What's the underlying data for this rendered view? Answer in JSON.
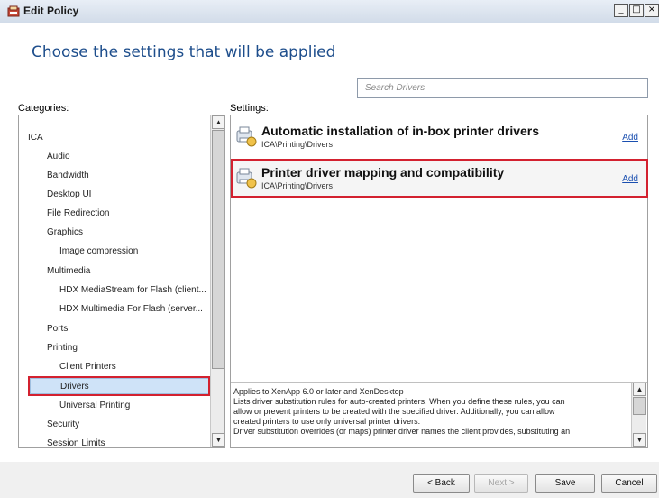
{
  "window": {
    "title": "Edit Policy",
    "controls": {
      "minimize": "_",
      "maximize": "□",
      "close": "×"
    }
  },
  "heading": "Choose the settings that will be applied",
  "search": {
    "placeholder": "Search Drivers"
  },
  "categories": {
    "label": "Categories:",
    "items": [
      {
        "label": "ICA",
        "level": 0,
        "selected": false
      },
      {
        "label": "Audio",
        "level": 1,
        "selected": false
      },
      {
        "label": "Bandwidth",
        "level": 1,
        "selected": false
      },
      {
        "label": "Desktop UI",
        "level": 1,
        "selected": false
      },
      {
        "label": "File Redirection",
        "level": 1,
        "selected": false
      },
      {
        "label": "Graphics",
        "level": 1,
        "selected": false
      },
      {
        "label": "Image compression",
        "level": 2,
        "selected": false
      },
      {
        "label": "Multimedia",
        "level": 1,
        "selected": false
      },
      {
        "label": "HDX MediaStream for Flash (client...",
        "level": 2,
        "selected": false
      },
      {
        "label": "HDX Multimedia For Flash (server...",
        "level": 2,
        "selected": false
      },
      {
        "label": "Ports",
        "level": 1,
        "selected": false
      },
      {
        "label": "Printing",
        "level": 1,
        "selected": false
      },
      {
        "label": "Client Printers",
        "level": 2,
        "selected": false
      },
      {
        "label": "Drivers",
        "level": 2,
        "selected": true
      },
      {
        "label": "Universal Printing",
        "level": 2,
        "selected": false
      },
      {
        "label": "Security",
        "level": 1,
        "selected": false
      },
      {
        "label": "Session Limits",
        "level": 1,
        "selected": false
      }
    ]
  },
  "settings": {
    "label": "Settings:",
    "items": [
      {
        "title": "Automatic installation of in-box printer drivers",
        "path": "ICA\\Printing\\Drivers",
        "action": "Add"
      },
      {
        "title": "Printer driver mapping and compatibility",
        "path": "ICA\\Printing\\Drivers",
        "action": "Add"
      }
    ]
  },
  "description": {
    "lines": [
      "Applies to XenApp 6.0 or later and XenDesktop",
      "Lists driver substitution rules for auto-created printers. When you define these rules, you can",
      "allow or prevent printers to be created with the specified driver. Additionally, you can allow",
      "created printers to use only universal printer drivers.",
      "Driver substitution overrides (or maps) printer driver names the client provides, substituting an"
    ]
  },
  "buttons": {
    "back": "< Back",
    "next": "Next >",
    "save": "Save",
    "cancel": "Cancel"
  },
  "colors": {
    "heading": "#1e4e8c",
    "highlight_border": "#d3212f",
    "link": "#1a4fb0",
    "selection": "#cfe3f8"
  }
}
